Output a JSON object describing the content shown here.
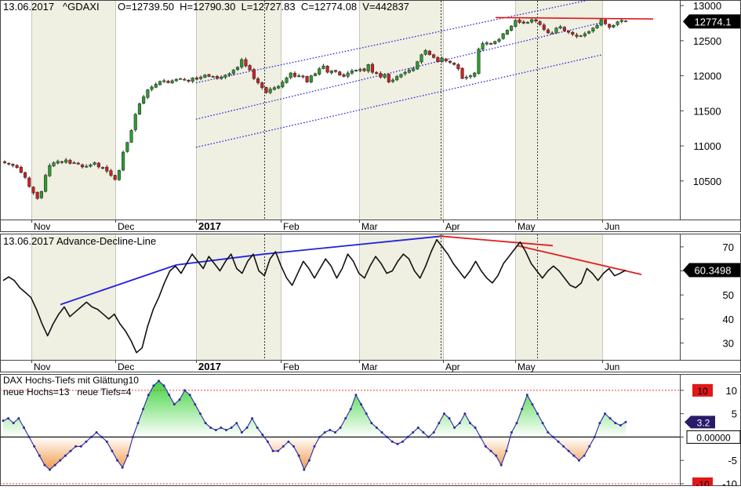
{
  "header": {
    "date": "13.06.2017",
    "symbol": "^GDAXI",
    "ohlcv": "O=12739.50  H=12790.30  L=12727.83  C=12774.08  V=442837"
  },
  "months": [
    "Nov",
    "Dec",
    "2017",
    "Feb",
    "Mar",
    "Apr",
    "May",
    "Jun"
  ],
  "colors": {
    "up_candle": "#2e9a2e",
    "down_candle": "#d02020",
    "channel": "#1c1cdd",
    "resistance": "#e01818",
    "ad_uptrend": "#2222dd",
    "ad_downtrend": "#e02020",
    "hl_positive_fill": "#3fd33f",
    "hl_negative_fill": "#f09a4a",
    "current_price_badge": "#000000",
    "hl_current_badge": "#2a1a6a",
    "limit_badge": "#e01818"
  },
  "chart_data": [
    {
      "type": "candlestick",
      "title": "13.06.2017 ^GDAXI",
      "ohlc_last": {
        "open": 12739.5,
        "high": 12790.3,
        "low": 12727.83,
        "close": 12774.08,
        "volume": 442837
      },
      "x_ticks": [
        "Nov",
        "Dec",
        "2017",
        "Feb",
        "Mar",
        "Apr",
        "May",
        "Jun"
      ],
      "y_ticks": [
        13000,
        12500,
        12000,
        11500,
        11000,
        10500
      ],
      "ylim": [
        9950,
        13080
      ],
      "last_price_label": "12774.1",
      "close_series": [
        10760,
        10740,
        10720,
        10690,
        10620,
        10550,
        10420,
        10330,
        10250,
        10350,
        10580,
        10720,
        10760,
        10780,
        10770,
        10800,
        10750,
        10760,
        10740,
        10700,
        10710,
        10730,
        10760,
        10700,
        10690,
        10640,
        10580,
        10520,
        10650,
        10910,
        11050,
        11220,
        11450,
        11600,
        11700,
        11800,
        11840,
        11880,
        11920,
        11930,
        11900,
        11930,
        11950,
        11960,
        11940,
        11920,
        11970,
        11950,
        11980,
        12010,
        11990,
        11990,
        11960,
        11980,
        12010,
        12030,
        12080,
        12120,
        12230,
        12140,
        12080,
        11960,
        11900,
        11830,
        11760,
        11810,
        11830,
        11850,
        11910,
        11970,
        12040,
        11990,
        12000,
        11990,
        11910,
        12000,
        12030,
        12100,
        12140,
        12050,
        12070,
        12060,
        12010,
        11990,
        12040,
        12070,
        12080,
        12090,
        12070,
        12160,
        12050,
        12030,
        11980,
        12020,
        11910,
        11940,
        11990,
        12020,
        12050,
        12080,
        12100,
        12200,
        12300,
        12360,
        12300,
        12260,
        12200,
        12250,
        12210,
        12190,
        12160,
        12100,
        11960,
        11980,
        12000,
        12040,
        12380,
        12460,
        12470,
        12460,
        12490,
        12520,
        12600,
        12650,
        12710,
        12790,
        12760,
        12750,
        12760,
        12800,
        12780,
        12730,
        12660,
        12610,
        12610,
        12680,
        12700,
        12640,
        12620,
        12590,
        12560,
        12570,
        12600,
        12630,
        12680,
        12720,
        12800,
        12740,
        12690,
        12720,
        12770,
        12790,
        12774
      ],
      "channel": {
        "upper": [
          {
            "x": "Jan",
            "y": 11900
          },
          {
            "x": "Jun",
            "y": 13120
          }
        ],
        "middle": [
          {
            "x": "Jan",
            "y": 11380
          },
          {
            "x": "Jun",
            "y": 12760
          }
        ],
        "lower": [
          {
            "x": "Jan",
            "y": 10980
          },
          {
            "x": "Jun",
            "y": 12300
          }
        ]
      },
      "resistance": [
        {
          "x": "May",
          "y": 12830
        },
        {
          "x": "Jun",
          "y": 12810
        }
      ]
    },
    {
      "type": "line",
      "title": "13.06.2017 Advance-Decline-Line",
      "x_ticks": [
        "Nov",
        "Dec",
        "2017",
        "Feb",
        "Mar",
        "Apr",
        "May",
        "Jun"
      ],
      "y_ticks": [
        70,
        60,
        50,
        40,
        30
      ],
      "ylim": [
        23,
        75.5
      ],
      "last_value_label": "60.3498",
      "values": [
        56,
        57.5,
        56,
        53,
        51,
        49,
        44,
        38,
        33,
        38,
        42,
        45,
        41,
        43,
        45,
        47,
        45,
        44,
        42,
        40,
        42,
        38,
        35,
        31,
        26,
        28,
        37,
        44,
        49,
        55,
        60,
        62,
        59,
        63,
        67,
        64,
        61,
        66,
        63,
        60,
        64,
        67,
        61,
        59,
        64,
        67,
        60,
        58,
        65,
        68,
        62,
        57,
        54,
        59,
        64,
        61,
        57,
        61,
        65,
        62,
        57,
        61,
        67,
        64,
        59,
        57,
        62,
        66,
        63,
        59,
        60,
        64,
        67,
        65,
        60,
        57,
        62,
        68,
        73,
        70,
        67,
        63,
        60,
        57,
        60,
        64,
        60,
        57,
        55,
        58,
        63,
        66,
        69,
        72,
        68,
        63,
        60,
        57,
        60,
        62,
        60,
        57,
        54,
        53,
        55,
        61,
        59,
        56,
        59,
        61,
        58,
        59,
        60.35
      ],
      "trendlines": [
        {
          "color": "blue",
          "points": [
            {
              "x": "Nov",
              "y": 46
            },
            {
              "x": "Dec",
              "y": 62.5
            }
          ]
        },
        {
          "color": "blue",
          "points": [
            {
              "x": "Dec",
              "y": 62.5
            },
            {
              "x": "Feb",
              "y": 67
            }
          ]
        },
        {
          "color": "blue",
          "points": [
            {
              "x": "Feb",
              "y": 67
            },
            {
              "x": "Apr",
              "y": 74.5
            }
          ]
        },
        {
          "color": "red",
          "points": [
            {
              "x": "Apr",
              "y": 74.5
            },
            {
              "x": "May",
              "y": 70.5
            }
          ]
        },
        {
          "color": "red",
          "points": [
            {
              "x": "May",
              "y": 70.5
            },
            {
              "x": "Jun",
              "y": 58.5
            }
          ]
        }
      ]
    },
    {
      "type": "area",
      "title": "DAX Hochs-Tiefs mit Glättung10",
      "subtitle": "neue Hochs=13   neue Tiefs=4",
      "x_ticks": [
        "Nov",
        "Dec",
        "2017",
        "Feb",
        "Mar",
        "Apr",
        "May",
        "Jun"
      ],
      "y_ticks": [
        10,
        5,
        0,
        -5,
        -10
      ],
      "ylim": [
        -10.5,
        13.5
      ],
      "reference_lines": [
        10,
        0,
        -10
      ],
      "badges": {
        "upper_limit": "10",
        "current": "3.2",
        "zero": "0.00000",
        "lower_limit": "-10"
      },
      "values": [
        3.5,
        4,
        3,
        4,
        2,
        0,
        -2,
        -4,
        -6,
        -7,
        -6,
        -5,
        -4,
        -3,
        -2,
        -2,
        -1,
        0,
        1,
        0,
        -1,
        -3,
        -5,
        -6.5,
        -4,
        0,
        3,
        6,
        9,
        11,
        12,
        11,
        9,
        7,
        8,
        10,
        9,
        7,
        5,
        3,
        2,
        1.5,
        2,
        1.5,
        2,
        3,
        1,
        2,
        4,
        2,
        0.5,
        -1,
        -3,
        -3,
        -2,
        -1,
        -2,
        -4,
        -7,
        -5,
        -2,
        0,
        1,
        1.5,
        1,
        2,
        4,
        6,
        9,
        7,
        5,
        3,
        2,
        1,
        0,
        -1,
        -1.5,
        -1,
        0,
        1,
        2,
        1,
        0,
        1,
        3,
        5,
        4,
        2,
        3,
        5,
        3,
        2,
        0,
        -2,
        -3,
        -4,
        -6,
        -3,
        1,
        3,
        6,
        9,
        7,
        5,
        3,
        1,
        0,
        -1,
        -2,
        -3,
        -4,
        -5,
        -4,
        -2,
        0,
        3,
        5,
        4,
        3,
        2.5,
        3.2
      ]
    }
  ]
}
